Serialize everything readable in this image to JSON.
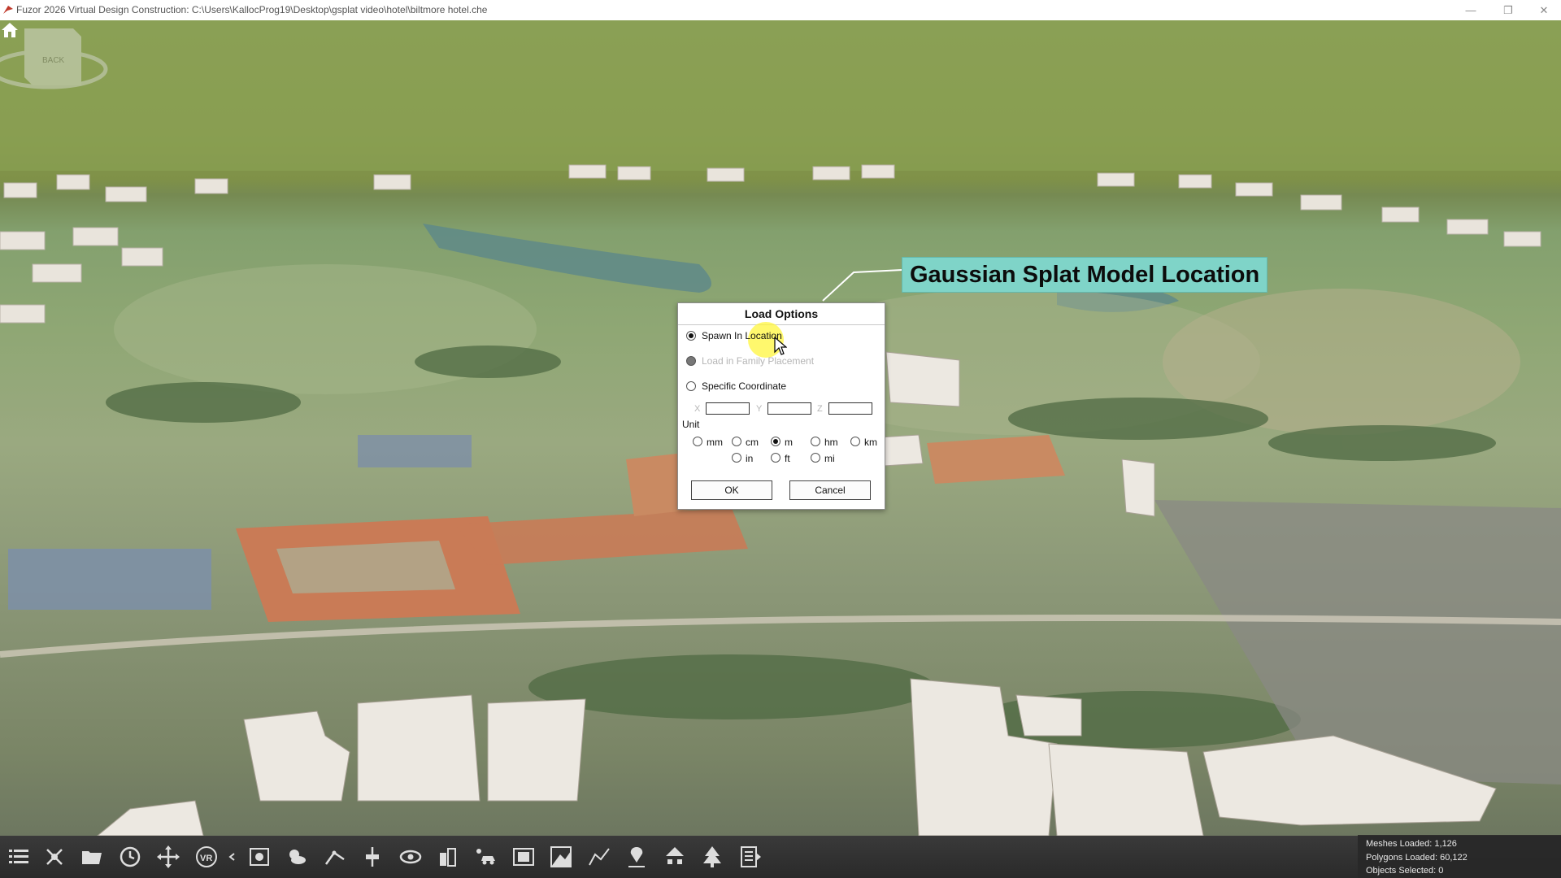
{
  "window": {
    "title": "Fuzor 2026 Virtual Design Construction: C:\\Users\\KallocProg19\\Desktop\\gsplat video\\hotel\\biltmore hotel.che",
    "minimize": "—",
    "maximize": "❐",
    "close": "✕"
  },
  "viewport": {
    "callout": "Gaussian Splat Model Location",
    "viewcube_label": "BACK"
  },
  "dialog": {
    "title": "Load Options",
    "options": [
      {
        "label": "Spawn In Location",
        "selected": true,
        "enabled": true
      },
      {
        "label": "Load in Family Placement",
        "selected": false,
        "enabled": false
      },
      {
        "label": "Specific Coordinate",
        "selected": false,
        "enabled": true
      }
    ],
    "coords": {
      "x_label": "X",
      "y_label": "Y",
      "z_label": "Z",
      "x": "",
      "y": "",
      "z": ""
    },
    "unit_label": "Unit",
    "units": [
      {
        "label": "mm",
        "selected": false
      },
      {
        "label": "cm",
        "selected": false
      },
      {
        "label": "m",
        "selected": true
      },
      {
        "label": "hm",
        "selected": false
      },
      {
        "label": "km",
        "selected": false
      },
      {
        "label": "in",
        "selected": false
      },
      {
        "label": "ft",
        "selected": false
      },
      {
        "label": "mi",
        "selected": false
      }
    ],
    "ok_label": "OK",
    "cancel_label": "Cancel"
  },
  "toolbar": {
    "icons": [
      "list-icon",
      "drone-icon",
      "folder-icon",
      "clock-icon",
      "move-icon",
      "vr-icon",
      "collapse-arrow-icon",
      "camera-icon",
      "weather-icon",
      "measure-icon",
      "section-icon",
      "eye-icon",
      "building-icon",
      "vehicle-icon",
      "film-icon",
      "terrain-icon",
      "path-icon",
      "location-pin-icon",
      "network-icon",
      "tree-icon",
      "report-icon"
    ]
  },
  "stats": {
    "meshes": "Meshes Loaded: 1,126",
    "polygons": "Polygons Loaded: 60,122",
    "objects": "Objects Selected: 0"
  }
}
